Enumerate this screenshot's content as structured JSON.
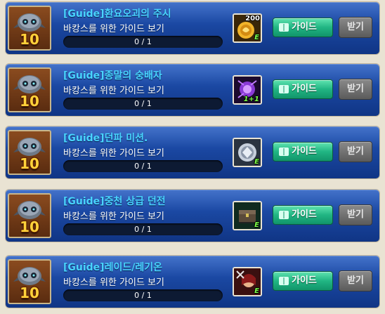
{
  "quests": [
    {
      "title": "[Guide]환요오괴의 주시",
      "description": "바캉스를 위한 가이드 보기",
      "progress_text": "0 / 1",
      "progress": 0,
      "level": "10",
      "reward_icon": "gold-coin-icon",
      "reward_count": "200",
      "reward_badge": "E",
      "guide_label": "가이드",
      "receive_label": "받기"
    },
    {
      "title": "[Guide]종말의 숭배자",
      "description": "바캉스를 위한 가이드 보기",
      "progress_text": "0 / 1",
      "progress": 0,
      "level": "10",
      "reward_icon": "purple-potion-icon",
      "reward_count": "",
      "reward_badge": "1+1",
      "guide_label": "가이드",
      "receive_label": "받기"
    },
    {
      "title": "[Guide]던파 미션.",
      "description": "바캉스를 위한 가이드 보기",
      "progress_text": "0 / 1",
      "progress": 0,
      "level": "10",
      "reward_icon": "silver-emblem-icon",
      "reward_count": "",
      "reward_badge": "E",
      "guide_label": "가이드",
      "receive_label": "받기"
    },
    {
      "title": "[Guide]중천 상급 던전",
      "description": "바캉스를 위한 가이드 보기",
      "progress_text": "0 / 1",
      "progress": 0,
      "level": "10",
      "reward_icon": "treasure-chest-icon",
      "reward_count": "",
      "reward_badge": "E",
      "guide_label": "가이드",
      "receive_label": "받기"
    },
    {
      "title": "[Guide]레이드/레기온",
      "description": "바캉스를 위한 가이드 보기",
      "progress_text": "0 / 1",
      "progress": 0,
      "level": "10",
      "reward_icon": "character-portrait-icon",
      "reward_count": "",
      "reward_badge": "E",
      "guide_label": "가이드",
      "receive_label": "받기"
    }
  ],
  "colors": {
    "panel_blue": "#1a47a1",
    "title_cyan": "#49d4ff",
    "level_gold": "#ffd23a",
    "guide_green": "#21b583",
    "receive_gray": "#6e6e6e"
  }
}
